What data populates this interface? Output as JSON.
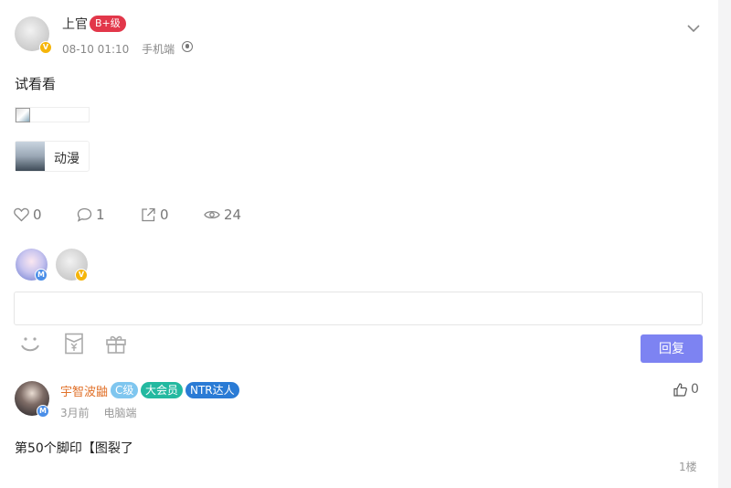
{
  "post": {
    "author": "上官",
    "level": "B+级",
    "time": "08-10 01:10",
    "client": "手机端",
    "text": "试看看",
    "topic": "动漫",
    "stats": {
      "likes": "0",
      "comments": "1",
      "shares": "0",
      "views": "24"
    },
    "badge_v": "V"
  },
  "liker_avatars": [
    {
      "badge": "M"
    },
    {
      "badge": "V"
    }
  ],
  "reply": {
    "button_label": "回复",
    "placeholder": ""
  },
  "comment": {
    "author": "宇智波鼬",
    "tags": [
      "C级",
      "大会员",
      "NTR达人"
    ],
    "badge": "M",
    "time": "3月前",
    "client": "电脑端",
    "likes": "0",
    "text": "第50个脚印【图裂了",
    "floor": "1楼"
  },
  "colors": {
    "accent": "#7d83f2",
    "level_tag": "#e2374a",
    "name_orange": "#e1722b"
  }
}
